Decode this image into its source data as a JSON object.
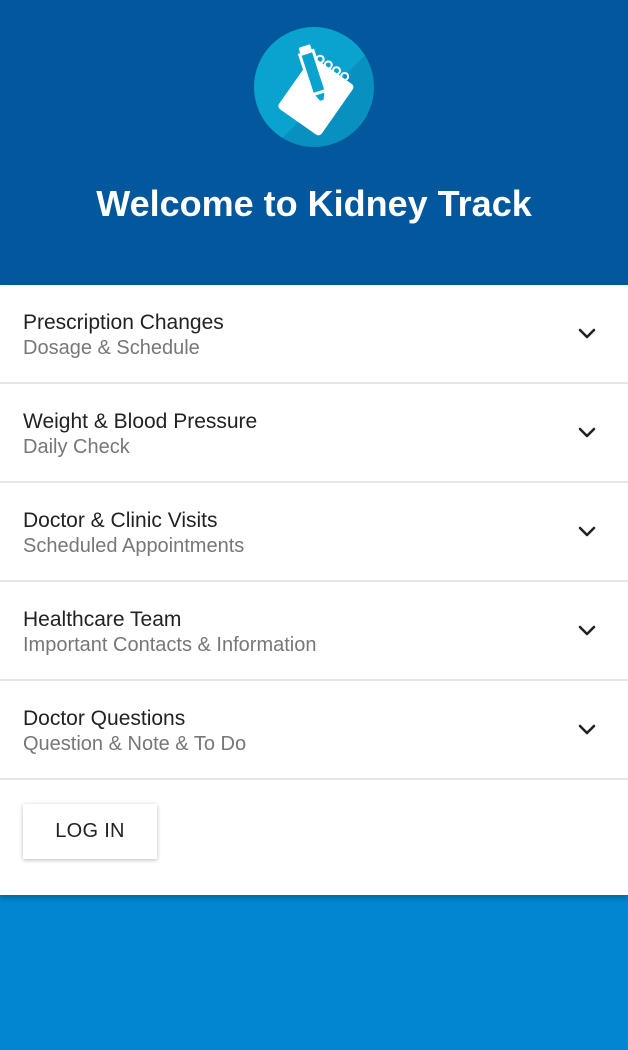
{
  "header": {
    "title": "Welcome to Kidney Track",
    "logo_icon": "notepad-pen-icon",
    "background": "#02579d"
  },
  "menu": {
    "items": [
      {
        "title": "Prescription Changes",
        "subtitle": "Dosage & Schedule"
      },
      {
        "title": "Weight & Blood Pressure",
        "subtitle": "Daily Check"
      },
      {
        "title": "Doctor & Clinic Visits",
        "subtitle": "Scheduled Appointments"
      },
      {
        "title": "Healthcare Team",
        "subtitle": "Important Contacts & Information"
      },
      {
        "title": "Doctor Questions",
        "subtitle": "Question & Note & To Do"
      }
    ],
    "expand_icon": "chevron-down-icon"
  },
  "actions": {
    "login_label": "LOG IN"
  },
  "colors": {
    "header_bg": "#02579d",
    "page_bg": "#0286d1",
    "logo_bg": "#0aa3cf"
  }
}
